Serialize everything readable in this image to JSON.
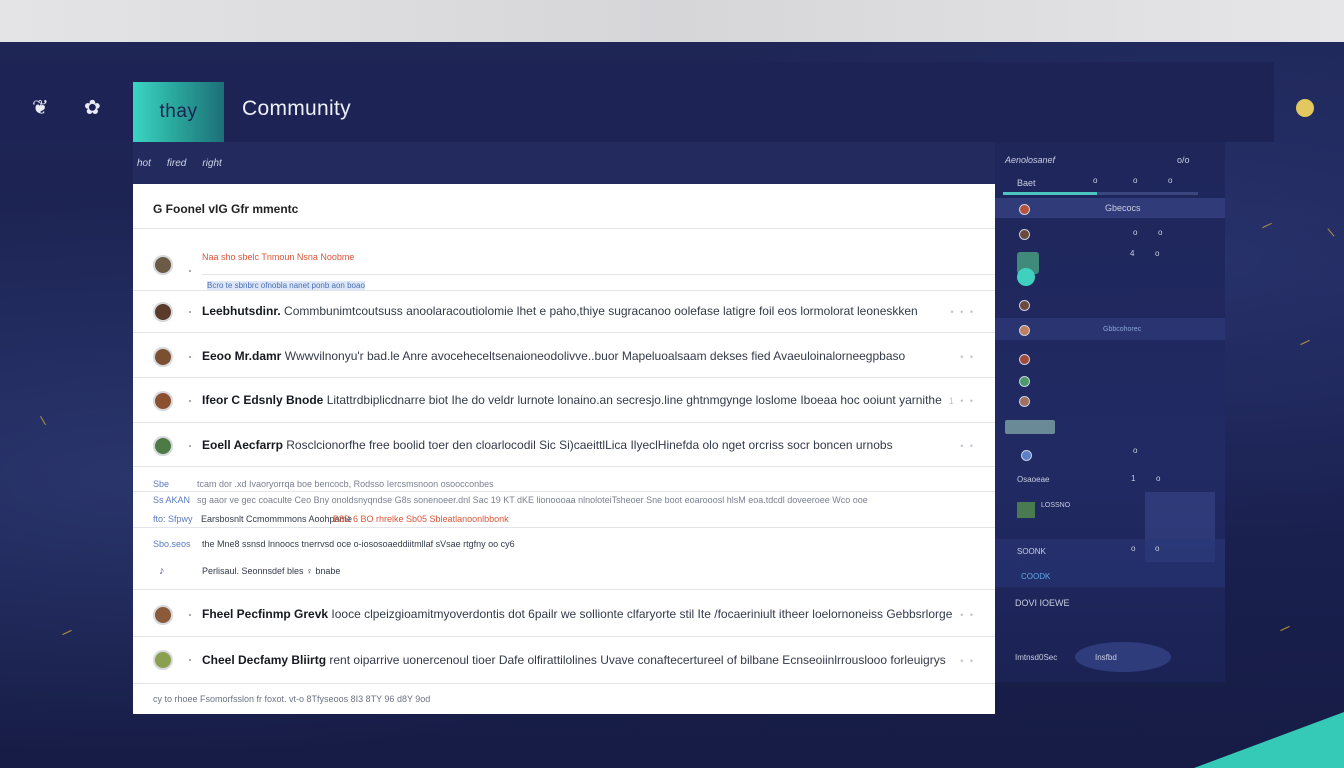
{
  "header": {
    "brand": "thay",
    "title": "Community",
    "icons": [
      "leaf-icon",
      "paw-icon"
    ]
  },
  "toolbar": {
    "tabs": [
      "hot",
      "fired",
      "right"
    ]
  },
  "forum": {
    "title": "G Foonel vIG Gfr mmentc",
    "featured": {
      "line1": "Naa sho sbelc Tnmoun Nsna Noobme",
      "line2": "Bcro te sbnbrc ofnobla nanet ponb aon boao"
    },
    "threads": [
      {
        "author": "Leebhutsdinr.",
        "text": "Commbunimtcoutsuss anoolaracoutiolomie lhet e paho,thiye sugracanoo oolefase latigre foil eos lormolorat leoneskken",
        "meta": "• • •"
      },
      {
        "author": "Eeoo Mr.damr",
        "text": "Wwwvilnonyu'r bad.le  Anre avoceheceltsenaioneodolivve..buor Mapeluoalsaam dekses fied Avaeuloinalorneegpbaso",
        "meta": "• •"
      },
      {
        "author": "Ifeor C Edsnly Bnode",
        "text": "Litattrdbiplicdnarre biot Ihe do veldr lurnote lonaino.an secresjo.line ghtnmgynge loslome Iboeaa hoc ooiunt yarnithe",
        "meta": "1 • •"
      },
      {
        "author": "Eoell Aecfarrp",
        "text": "Rosclcionorfhe free boolid toer den cloarlocodil Sic Si)caeittlLica IlyeclHinefda olo nget orcriss socr boncen urnobs",
        "meta": "• •"
      }
    ],
    "notice": {
      "l1_tag": "Sbe",
      "l1": "tcam dor .xd  Ivaoryorrqa boe bencocb,  Rodsso Iercsmsnoon  osoocconbes",
      "l2_tag": "Ss AKAN",
      "l2": "sg aaor ve gec coaculte Ceo Bny  onoldsnyqndse G8s sonenoeer.dnl Sac 19 KT dKE lionoooaa nlnoloteiTsheoer Sne boot eoarooosl hlsM eoa.tdcdl doveeroee Wco ooe",
      "l3_tag": "fto: Sfpwy",
      "l3_a": "Earsbosnlt Ccmommmons Aoohpame",
      "l3_b": "B8D 6 BO  rhrelke Sb05 Sbleatlanoonlbbonk",
      "l4_tag": "Sbo.seos",
      "l4": "the Mne8 ssnsd lnnoocs tnerrvsd oce o-iososoaeddiitmllaf sVsae rtgfny oo cy6",
      "l5": "Perlisaul. Seonnsdef bles ♀ bnabe"
    },
    "threads2": [
      {
        "author": "Fheel Pecfinmp Grevk",
        "text": "Iooce clpeizgioamitmyoverdontis dot 6pailr we sollionte clfaryorte stil Ite /focaeriniult itheer loelornoneiss Gebbsrlorge",
        "meta": "• •"
      },
      {
        "author": "Cheel Decfamy Bliirtg",
        "text": "rent oiparrive uonercenoul tioer Dafe olfirattilolines Uvave conaftecertureel of bilbane Ecnseoiinlrrouslooo forleuigrys",
        "meta": "• •"
      }
    ],
    "footer": "cy to rhoee Fsomorfsslon fr foxot.  vt-o 8Tfyseoos 8I3 8TY 96 d8Y 9od"
  },
  "sidebar": {
    "header": "Aenolosanef",
    "header_right": "o/o",
    "rows": [
      {
        "label": "Baet",
        "marks": [
          "o",
          "o",
          "o"
        ]
      },
      {
        "label": "Gbecocs"
      },
      {
        "label": "",
        "marks": [
          "o",
          "o"
        ]
      },
      {
        "label": "",
        "marks": [
          "4",
          "o"
        ]
      },
      {
        "label": "Gbbcohorec"
      },
      {
        "label": "Osaoeae",
        "marks": [
          "1",
          "o"
        ]
      },
      {
        "label": "LOSSNO"
      },
      {
        "label": "SOONK",
        "marks": [
          "o",
          "o"
        ]
      },
      {
        "label": "COODK"
      },
      {
        "label": "DOVI IOEWE"
      },
      {
        "label": "Imtnsd0Sec",
        "right": "Insfbd"
      }
    ]
  },
  "colors": {
    "accent": "#35c9b7",
    "background": "#1c2350",
    "panel": "#ffffff",
    "status": "#e2c85e"
  }
}
